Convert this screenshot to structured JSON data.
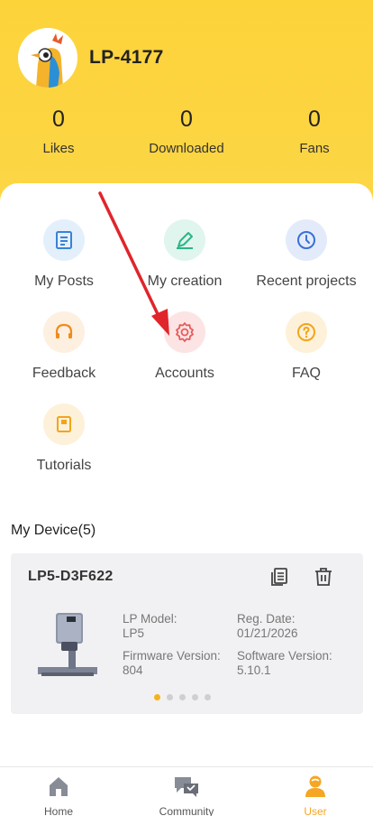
{
  "profile": {
    "username": "LP-4177",
    "stats": [
      {
        "value": "0",
        "label": "Likes"
      },
      {
        "value": "0",
        "label": "Downloaded"
      },
      {
        "value": "0",
        "label": "Fans"
      }
    ]
  },
  "menu": [
    {
      "label": "My Posts",
      "icon": "document-icon",
      "color": "#3b82d6"
    },
    {
      "label": "My creation",
      "icon": "pencil-icon",
      "color": "#2bb58a"
    },
    {
      "label": "Recent projects",
      "icon": "clock-icon",
      "color": "#3b6fd6"
    },
    {
      "label": "Feedback",
      "icon": "headset-icon",
      "color": "#f28a1c"
    },
    {
      "label": "Accounts",
      "icon": "gear-icon",
      "color": "#e85a5a"
    },
    {
      "label": "FAQ",
      "icon": "question-icon",
      "color": "#f2a51c"
    },
    {
      "label": "Tutorials",
      "icon": "book-icon",
      "color": "#f2a51c"
    }
  ],
  "devices": {
    "title": "My Device(5)",
    "card": {
      "name": "LP5-D3F622",
      "model_label": "LP Model:",
      "model_value": "LP5",
      "reg_label": "Reg. Date:",
      "reg_value": "01/21/2026",
      "firmware_label": "Firmware Version:",
      "firmware_value": "804",
      "software_label": "Software Version:",
      "software_value": "5.10.1"
    },
    "pagination": {
      "count": 5,
      "active": 1
    }
  },
  "nav": [
    {
      "label": "Home",
      "icon": "home-icon"
    },
    {
      "label": "Community",
      "icon": "chat-icon"
    },
    {
      "label": "User",
      "icon": "user-icon",
      "active": true
    }
  ],
  "colors": {
    "header": "#fdd33a",
    "accent": "#f5a623",
    "arrow": "#e0252b"
  }
}
